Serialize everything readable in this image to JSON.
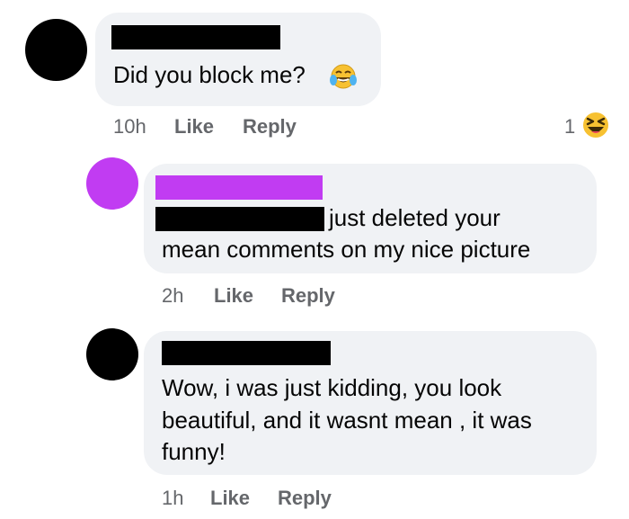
{
  "comments": [
    {
      "avatar_color": "#000000",
      "lines": [
        "Did you block me?"
      ],
      "inline_emoji": "tears-of-joy-emoji",
      "time": "10h",
      "like_label": "Like",
      "reply_label": "Reply",
      "reaction": {
        "count": "1",
        "icon": "laughing-squint-emoji"
      }
    },
    {
      "avatar_color": "#c13cf2",
      "name_redact_color": "#c13cf2",
      "lines": [
        "just deleted your",
        "mean comments on my nice picture"
      ],
      "time": "2h",
      "like_label": "Like",
      "reply_label": "Reply"
    },
    {
      "avatar_color": "#000000",
      "lines": [
        "Wow, i was just kidding, you look",
        "beautiful, and it wasnt mean , it was",
        "funny!"
      ],
      "time": "1h",
      "like_label": "Like",
      "reply_label": "Reply"
    }
  ],
  "colors": {
    "bubble_bg": "#f0f2f5",
    "meta_text": "#65676b",
    "redaction_black": "#000000",
    "redaction_purple": "#c13cf2"
  }
}
